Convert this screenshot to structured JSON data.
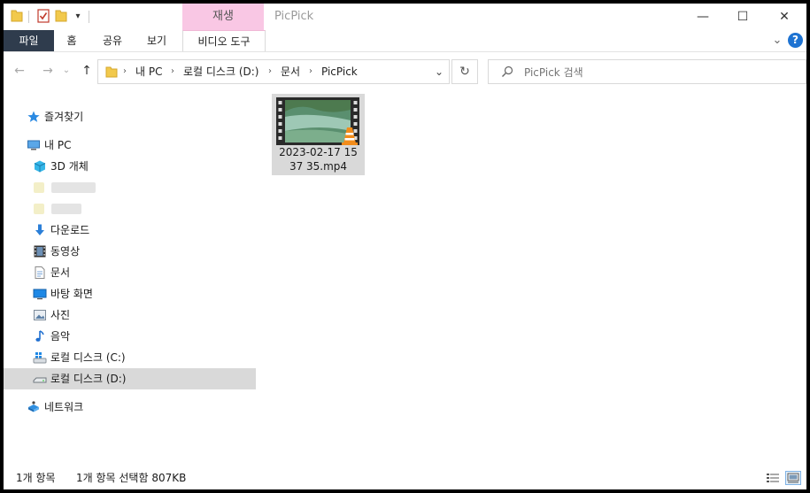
{
  "window": {
    "app_title": "PicPick",
    "context_tab_header": "재생",
    "controls": {
      "minimize": "—",
      "maximize": "☐",
      "close": "✕"
    }
  },
  "ribbon": {
    "tabs": [
      "파일",
      "홈",
      "공유",
      "보기"
    ],
    "context_tab": "비디오 도구",
    "collapse_glyph": "⌄",
    "help_glyph": "?"
  },
  "nav_buttons": {
    "back": "←",
    "forward": "→",
    "recent": "⌄",
    "up": "↑"
  },
  "address": {
    "crumbs": [
      "내 PC",
      "로컬 디스크 (D:)",
      "문서",
      "PicPick"
    ],
    "separator": "›",
    "dropdown": "⌄",
    "refresh": "↻"
  },
  "search": {
    "placeholder": "PicPick 검색",
    "value": ""
  },
  "nav_pane": {
    "quick_access": "즐겨찾기",
    "this_pc": "내 PC",
    "objects_3d": "3D 개체",
    "downloads": "다운로드",
    "videos": "동영상",
    "documents": "문서",
    "desktop": "바탕 화면",
    "pictures": "사진",
    "music": "음악",
    "drive_c": "로컬 디스크 (C:)",
    "drive_d": "로컬 디스크 (D:)",
    "network": "네트워크"
  },
  "files": [
    {
      "name_line1": "2023-02-17 15",
      "name_line2": "37 35.mp4",
      "selected": true
    }
  ],
  "status": {
    "item_count": "1개 항목",
    "selection": "1개 항목 선택함 807KB"
  },
  "colors": {
    "accent": "#2f3c4d",
    "context_pink": "#f9c7e4",
    "selection": "#d9d9d9",
    "help_blue": "#1e73d2"
  }
}
